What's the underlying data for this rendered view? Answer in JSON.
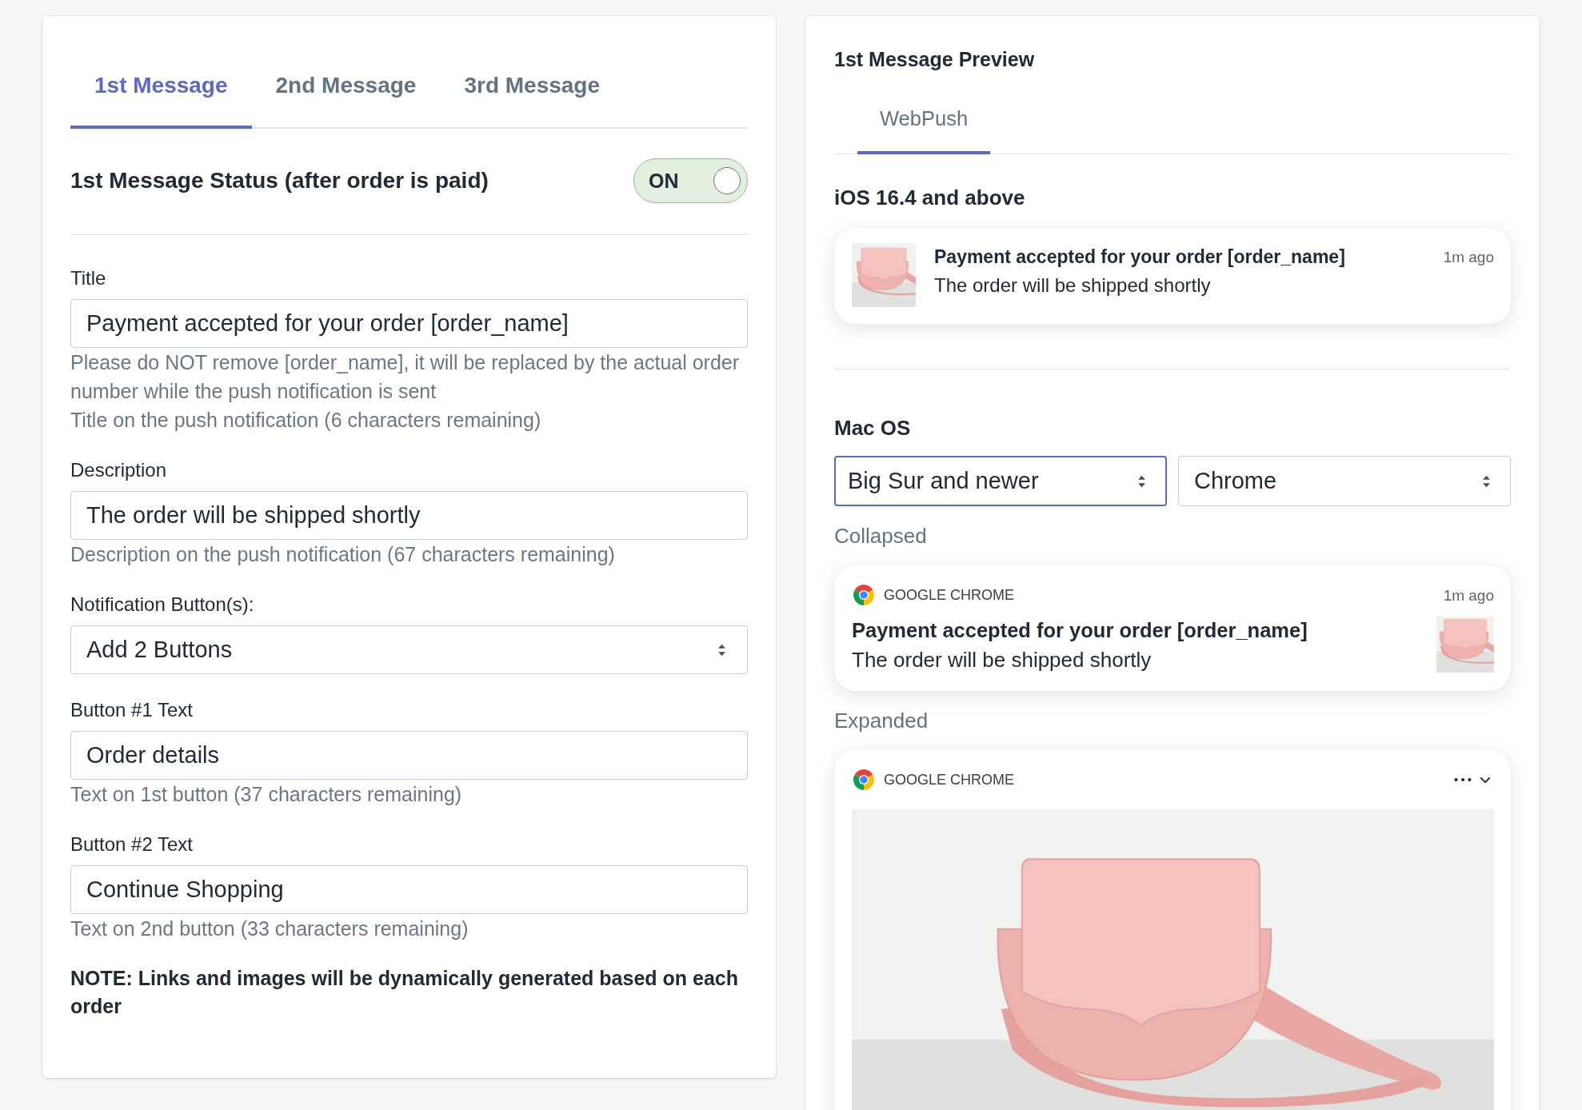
{
  "editor": {
    "tabs": [
      {
        "label": "1st Message",
        "selected": true
      },
      {
        "label": "2nd Message",
        "selected": false
      },
      {
        "label": "3rd Message",
        "selected": false
      }
    ],
    "status": {
      "label": "1st Message Status (after order is paid)",
      "toggle": {
        "label": "ON",
        "on": true
      }
    },
    "fields": [
      {
        "kind": "text",
        "label": "Title",
        "value": "Payment accepted for your order [order_name]",
        "help": [
          "Please do NOT remove [order_name], it will be replaced by the actual order number while the push notification is sent",
          "Title on the push notification (6 characters remaining)"
        ]
      },
      {
        "kind": "text",
        "label": "Description",
        "value": "The order will be shipped shortly",
        "help": [
          "Description on the push notification (67 characters remaining)"
        ]
      },
      {
        "kind": "select",
        "label": "Notification Button(s):",
        "value": "Add 2 Buttons"
      },
      {
        "kind": "text",
        "label": "Button #1 Text",
        "value": "Order details",
        "help": [
          "Text on 1st button (37 characters remaining)"
        ]
      },
      {
        "kind": "text",
        "label": "Button #2 Text",
        "value": "Continue Shopping",
        "help": [
          "Text on 2nd button (33 characters remaining)"
        ]
      }
    ],
    "note": "NOTE: Links and images will be dynamically generated based on each order"
  },
  "preview": {
    "title": "1st Message Preview",
    "tabs": [
      {
        "label": "WebPush",
        "selected": true
      }
    ],
    "ios": {
      "heading": "iOS 16.4 and above",
      "notification": {
        "title": "Payment accepted for your order [order_name]",
        "body": "The order will be shipped shortly",
        "time": "1m ago"
      }
    },
    "macos": {
      "heading": "Mac OS",
      "selects": [
        {
          "value": "Big Sur and newer",
          "focused": true
        },
        {
          "value": "Chrome",
          "focused": false
        }
      ],
      "collapsed": {
        "label": "Collapsed",
        "notification": {
          "app": "GOOGLE CHROME",
          "time": "1m ago",
          "title": "Payment accepted for your order [order_name]",
          "body": "The order will be shipped shortly"
        }
      },
      "expanded": {
        "label": "Expanded",
        "notification": {
          "app": "GOOGLE CHROME"
        }
      }
    }
  }
}
